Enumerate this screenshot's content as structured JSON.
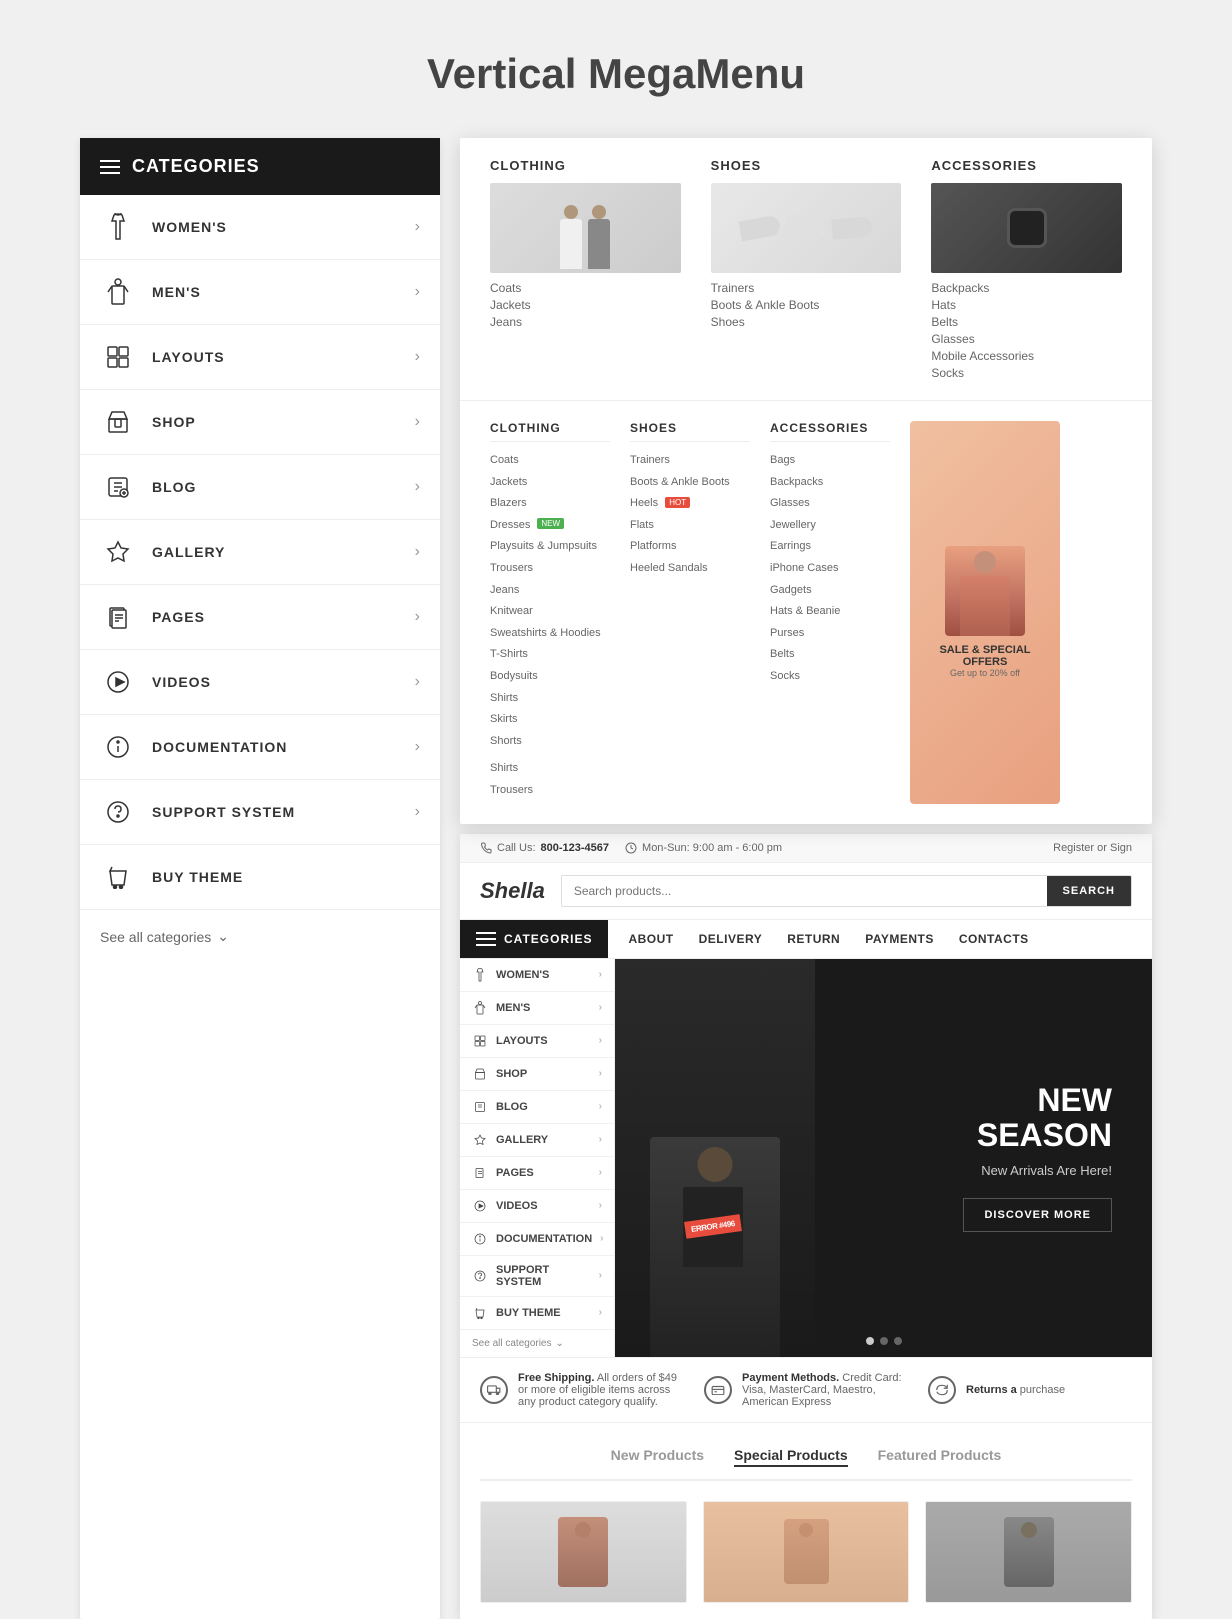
{
  "page": {
    "title": "Vertical MegaMenu"
  },
  "sidebar": {
    "header": "CATEGORIES",
    "items": [
      {
        "id": "womens",
        "label": "WOMEN'S",
        "icon": "womens"
      },
      {
        "id": "mens",
        "label": "MEN'S",
        "icon": "mens"
      },
      {
        "id": "layouts",
        "label": "LAYOUTS",
        "icon": "layouts"
      },
      {
        "id": "shop",
        "label": "SHOP",
        "icon": "shop"
      },
      {
        "id": "blog",
        "label": "BLOG",
        "icon": "blog"
      },
      {
        "id": "gallery",
        "label": "GALLERY",
        "icon": "gallery"
      },
      {
        "id": "pages",
        "label": "PAGES",
        "icon": "pages"
      },
      {
        "id": "videos",
        "label": "VIDEOS",
        "icon": "videos"
      },
      {
        "id": "documentation",
        "label": "DOCUMENTATION",
        "icon": "documentation"
      },
      {
        "id": "support",
        "label": "SUPPORT SYSTEM",
        "icon": "support"
      },
      {
        "id": "buy",
        "label": "BUY THEME",
        "icon": "buy"
      }
    ],
    "see_all": "See all categories"
  },
  "megamenu": {
    "columns_top": [
      {
        "title": "CLOTHING",
        "links": [
          "Coats",
          "Jackets",
          "Jeans"
        ]
      },
      {
        "title": "SHOES",
        "links": [
          "Trainers",
          "Boots & Ankle Boots",
          "Shoes"
        ]
      },
      {
        "title": "ACCESSORIES",
        "links": [
          "Backpacks",
          "Hats",
          "Belts",
          "Glasses",
          "Mobile Accessories",
          "Socks"
        ]
      }
    ],
    "columns_detail": {
      "clothing": {
        "title": "CLOTHING",
        "links": [
          "Coats",
          "Jackets",
          "Blazers",
          "Dresses",
          "Playsuits & Jumpsuits",
          "Trousers",
          "Jeans",
          "Knitwear",
          "Sweatshirts & Hoodies",
          "T-Shirts",
          "Bodysuits",
          "Shirts",
          "Skirts",
          "Shorts"
        ],
        "bottom_links": [
          "Shirts",
          "Trousers"
        ]
      },
      "shoes": {
        "title": "SHOES",
        "links": [
          "Trainers",
          "Boots & Ankle Boots",
          "Heels",
          "Flats",
          "Platforms",
          "Heeled Sandals"
        ]
      },
      "accessories": {
        "title": "ACCESSORIES",
        "links": [
          "Bags",
          "Backpacks",
          "Glasses",
          "Jewellery",
          "Earrings",
          "iPhone Cases",
          "Gadgets",
          "Hats & Beanie",
          "Purses",
          "Belts",
          "Socks"
        ]
      }
    },
    "sale_banner": {
      "title": "SALE & SPECIAL OFFERS",
      "subtitle": "Get up to 20% off"
    }
  },
  "preview": {
    "topbar": {
      "phone_label": "Call Us:",
      "phone": "800-123-4567",
      "hours": "Mon-Sun: 9:00 am - 6:00 pm",
      "register_text": "Register or Sign"
    },
    "logo": "Shella",
    "search_placeholder": "Search products...",
    "search_btn": "SEARCH",
    "nav": {
      "categories_label": "CATEGORIES",
      "items": [
        "ABOUT",
        "DELIVERY",
        "RETURN",
        "PAYMENTS",
        "CONTACTS"
      ]
    },
    "sidebar_items": [
      "WOMEN'S",
      "MEN'S",
      "LAYOUTS",
      "SHOP",
      "BLOG",
      "GALLERY",
      "PAGES",
      "VIDEOS",
      "DOCUMENTATION",
      "SUPPORT SYSTEM",
      "BUY THEME"
    ],
    "see_all": "See all categories",
    "hero": {
      "title": "NEW\nSEASON",
      "subtitle": "New Arrivals Are Here!",
      "btn": "DISCOVER MORE",
      "badge": "ERROR #496"
    },
    "features": [
      {
        "icon": "truck",
        "strong": "Free Shipping.",
        "text": "All orders of $49 or more of eligible items across any product category qualify."
      },
      {
        "icon": "card",
        "strong": "Payment Methods.",
        "text": "Credit Card: Visa, MasterCard, Maestro, American Express"
      },
      {
        "icon": "return",
        "strong": "Returns a",
        "text": "purchase"
      }
    ],
    "products_tabs": [
      "New Products",
      "Special Products",
      "Featured Products"
    ],
    "active_tab": "Special Products"
  }
}
